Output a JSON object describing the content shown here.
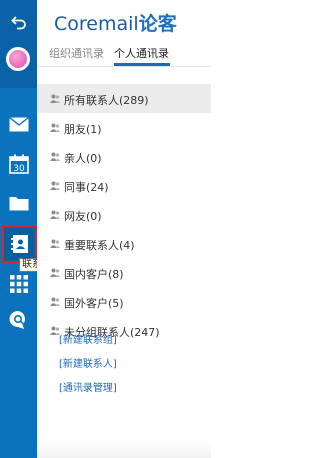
{
  "brand": {
    "name": "Coremail",
    "suffix": "论客"
  },
  "tabs": [
    {
      "label": "组织通讯录",
      "active": false
    },
    {
      "label": "个人通讯录",
      "active": true
    }
  ],
  "groups": [
    {
      "label": "所有联系人(289)",
      "selected": true
    },
    {
      "label": "朋友(1)",
      "selected": false
    },
    {
      "label": "亲人(0)",
      "selected": false
    },
    {
      "label": "同事(24)",
      "selected": false
    },
    {
      "label": "网友(0)",
      "selected": false
    },
    {
      "label": "重要联系人(4)",
      "selected": false
    },
    {
      "label": "国内客户(8)",
      "selected": false
    },
    {
      "label": "国外客户(5)",
      "selected": false
    },
    {
      "label": "未分组联系人(247)",
      "selected": false
    }
  ],
  "links": [
    {
      "label": "[新建联系组]"
    },
    {
      "label": "[新建联系人]"
    },
    {
      "label": "[通讯录管理]"
    }
  ],
  "tooltip": "联系人",
  "rail": {
    "items": [
      {
        "icon": "back-icon"
      },
      {
        "icon": "avatar-icon"
      },
      {
        "icon": "mail-icon"
      },
      {
        "icon": "calendar-icon",
        "text": "30"
      },
      {
        "icon": "folder-icon"
      },
      {
        "icon": "contacts-icon",
        "active": true
      },
      {
        "icon": "apps-grid-icon"
      },
      {
        "icon": "chat-icon"
      }
    ]
  },
  "colors": {
    "rail": "#0b72bd",
    "rail_top": "#0a63a8",
    "active_outline": "#d9262a",
    "link": "#1d6bb8",
    "brand": "#1a5c9c",
    "selected_row": "#ececec"
  }
}
